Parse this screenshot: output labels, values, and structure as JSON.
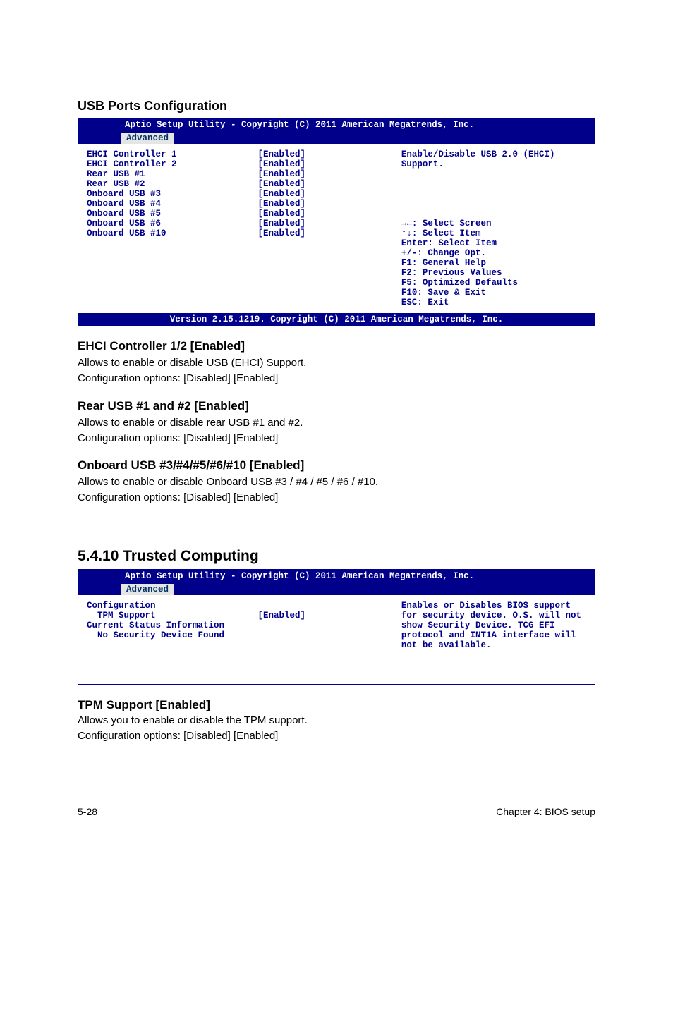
{
  "headings": {
    "usb_ports": "USB Ports Configuration",
    "ehci": "EHCI Controller 1/2 [Enabled]",
    "rear_usb": "Rear USB #1 and #2 [Enabled]",
    "onboard_usb": "Onboard USB #3/#4/#5/#6/#10 [Enabled]",
    "trusted": "5.4.10    Trusted Computing",
    "tpm": "TPM Support [Enabled]"
  },
  "paragraphs": {
    "ehci1": "Allows to enable or disable USB (EHCI) Support.",
    "ehci2": "Configuration options: [Disabled] [Enabled]",
    "rear1": "Allows to enable or disable rear USB #1 and #2.",
    "rear2": "Configuration options: [Disabled] [Enabled]",
    "ob1": "Allows to enable or disable Onboard USB #3 / #4 / #5 / #6 / #10.",
    "ob2": "Configuration options: [Disabled] [Enabled]",
    "tpm1": "Allows you to enable or disable the TPM support.",
    "tpm2": "Configuration options: [Disabled] [Enabled]"
  },
  "bios1": {
    "title": "Aptio Setup Utility - Copyright (C) 2011 American Megatrends, Inc.",
    "tab": "Advanced",
    "rows": [
      {
        "label": "EHCI Controller 1",
        "value": "[Enabled]"
      },
      {
        "label": "EHCI Controller 2",
        "value": "[Enabled]"
      },
      {
        "label": "",
        "value": ""
      },
      {
        "label": "",
        "value": ""
      },
      {
        "label": "Rear USB #1",
        "value": "[Enabled]"
      },
      {
        "label": "Rear USB #2",
        "value": "[Enabled]"
      },
      {
        "label": "Onboard USB #3",
        "value": "[Enabled]"
      },
      {
        "label": "Onboard USB #4",
        "value": "[Enabled]"
      },
      {
        "label": "Onboard USB #5",
        "value": "[Enabled]"
      },
      {
        "label": "Onboard USB #6",
        "value": "[Enabled]"
      },
      {
        "label": "Onboard USB #10",
        "value": "[Enabled]"
      }
    ],
    "help_top": "Enable/Disable USB 2.0 (EHCI) Support.",
    "help_keys": [
      "→←: Select Screen",
      "↑↓:  Select Item",
      "Enter: Select Item",
      "+/-: Change Opt.",
      "F1: General Help",
      "F2: Previous Values",
      "F5: Optimized Defaults",
      "F10: Save & Exit",
      "ESC: Exit"
    ],
    "footer": "Version 2.15.1219. Copyright (C) 2011 American Megatrends, Inc."
  },
  "bios2": {
    "title": "Aptio Setup Utility - Copyright (C) 2011 American Megatrends, Inc.",
    "tab": "Advanced",
    "rows": [
      {
        "label": "Configuration",
        "value": ""
      },
      {
        "label": "  TPM Support",
        "value": "[Enabled]"
      },
      {
        "label": "",
        "value": ""
      },
      {
        "label": "Current Status Information",
        "value": ""
      },
      {
        "label": "  No Security Device Found",
        "value": ""
      }
    ],
    "help_top": "Enables or Disables BIOS support for security device. O.S. will not show Security Device. TCG EFI protocol and INT1A interface will not be available."
  },
  "footer": {
    "left": "5-28",
    "right": "Chapter 4: BIOS setup"
  }
}
